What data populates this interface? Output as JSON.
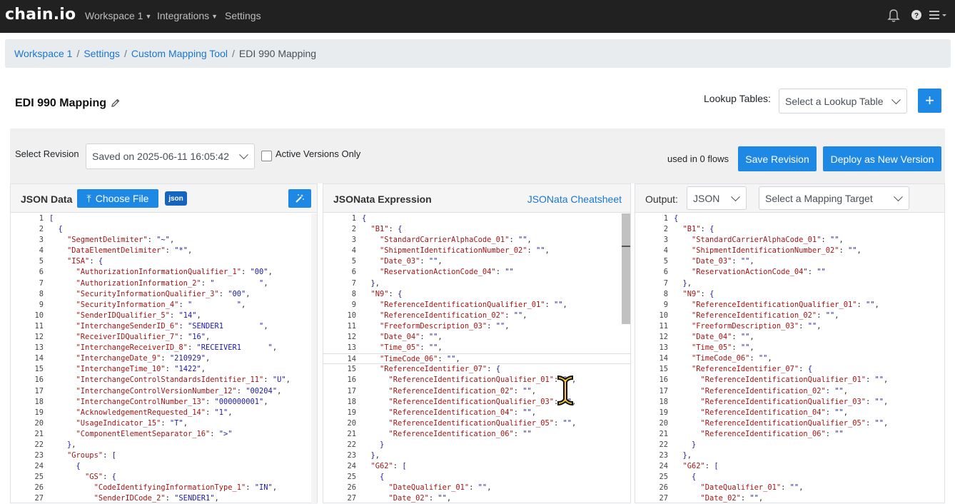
{
  "app": {
    "logo": "chain.io"
  },
  "nav": {
    "workspace": "Workspace 1",
    "integrations": "Integrations",
    "settings": "Settings"
  },
  "breadcrumb": [
    "Workspace 1",
    "Settings",
    "Custom Mapping Tool",
    "EDI 990 Mapping"
  ],
  "page": {
    "title": "EDI 990 Mapping"
  },
  "lookup": {
    "label": "Lookup Tables:",
    "placeholder": "Select a Lookup Table",
    "add_label": "+"
  },
  "revision": {
    "label": "Select Revision",
    "selected": "Saved on 2025-06-11 16:05:42",
    "active_only_label": "Active Versions Only",
    "used_in": "used in 0 flows",
    "save_label": "Save Revision",
    "deploy_label": "Deploy as New Version"
  },
  "panels": {
    "json_data": {
      "title": "JSON Data",
      "choose_file": "Choose File",
      "badge": "json"
    },
    "jsonata": {
      "title": "JSONata Expression",
      "cheatsheet": "JSONata Cheatsheet"
    },
    "output": {
      "title": "Output:",
      "format": "JSON",
      "target_placeholder": "Select a Mapping Target"
    }
  },
  "colors": {
    "accent": "#1e88e5",
    "topbar": "#212121",
    "link": "#1976d2"
  },
  "code": {
    "json_data": [
      "[",
      "  {",
      "    \"SegmentDelimiter\": \"~\",",
      "    \"DataElementDelimiter\": \"*\",",
      "    \"ISA\": {",
      "      \"AuthorizationInformationQualifier_1\": \"00\",",
      "      \"AuthorizationInformation_2\": \"          \",",
      "      \"SecurityInformationQualifier_3\": \"00\",",
      "      \"SecurityInformation_4\": \"          \",",
      "      \"SenderIDQualifier_5\": \"14\",",
      "      \"InterchangeSenderID_6\": \"SENDER1        \",",
      "      \"ReceiverIDQualifier_7\": \"16\",",
      "      \"InterchangeReceiverID_8\": \"RECEIVER1      \",",
      "      \"InterchangeDate_9\": \"210929\",",
      "      \"InterchangeTime_10\": \"1422\",",
      "      \"InterchangeControlStandardsIdentifier_11\": \"U\",",
      "      \"InterchangeControlVersionNumber_12\": \"00204\",",
      "      \"InterchangeControlNumber_13\": \"000000001\",",
      "      \"AcknowledgementRequested_14\": \"1\",",
      "      \"UsageIndicator_15\": \"T\",",
      "      \"ComponentElementSeparator_16\": \">\"",
      "    },",
      "    \"Groups\": [",
      "      {",
      "        \"GS\": {",
      "          \"CodeIdentifyingInformationType_1\": \"IN\",",
      "          \"SenderIDCode_2\": \"SENDER1\","
    ],
    "jsonata": [
      "{",
      "  \"B1\": {",
      "    \"StandardCarrierAlphaCode_01\": \"\",",
      "    \"ShipmentIdentificationNumber_02\": \"\",",
      "    \"Date_03\": \"\",",
      "    \"ReservationActionCode_04\": \"\"",
      "  },",
      "  \"N9\": {",
      "    \"ReferenceIdentificationQualifier_01\": \"\",",
      "    \"ReferenceIdentification_02\": \"\",",
      "    \"FreeformDescription_03\": \"\",",
      "    \"Date_04\": \"\",",
      "    \"Time_05\": \"\",",
      "    \"TimeCode_06\": \"\",",
      "    \"ReferenceIdentifier_07\": {",
      "      \"ReferenceIdentificationQualifier_01\": \"\",",
      "      \"ReferenceIdentification_02\": \"\",",
      "      \"ReferenceIdentificationQualifier_03\": \"\",",
      "      \"ReferenceIdentification_04\": \"\",",
      "      \"ReferenceIdentificationQualifier_05\": \"\",",
      "      \"ReferenceIdentification_06\": \"\"",
      "    }",
      "  },",
      "  \"G62\": [",
      "    {",
      "      \"DateQualifier_01\": \"\",",
      "      \"Date_02\": \"\","
    ],
    "output": [
      "{",
      "  \"B1\": {",
      "    \"StandardCarrierAlphaCode_01\": \"\",",
      "    \"ShipmentIdentificationNumber_02\": \"\",",
      "    \"Date_03\": \"\",",
      "    \"ReservationActionCode_04\": \"\"",
      "  },",
      "  \"N9\": {",
      "    \"ReferenceIdentificationQualifier_01\": \"\",",
      "    \"ReferenceIdentification_02\": \"\",",
      "    \"FreeformDescription_03\": \"\",",
      "    \"Date_04\": \"\",",
      "    \"Time_05\": \"\",",
      "    \"TimeCode_06\": \"\",",
      "    \"ReferenceIdentifier_07\": {",
      "      \"ReferenceIdentificationQualifier_01\": \"\",",
      "      \"ReferenceIdentification_02\": \"\",",
      "      \"ReferenceIdentificationQualifier_03\": \"\",",
      "      \"ReferenceIdentification_04\": \"\",",
      "      \"ReferenceIdentificationQualifier_05\": \"\",",
      "      \"ReferenceIdentification_06\": \"\"",
      "    }",
      "  },",
      "  \"G62\": [",
      "    {",
      "      \"DateQualifier_01\": \"\",",
      "      \"Date_02\": \"\","
    ]
  }
}
